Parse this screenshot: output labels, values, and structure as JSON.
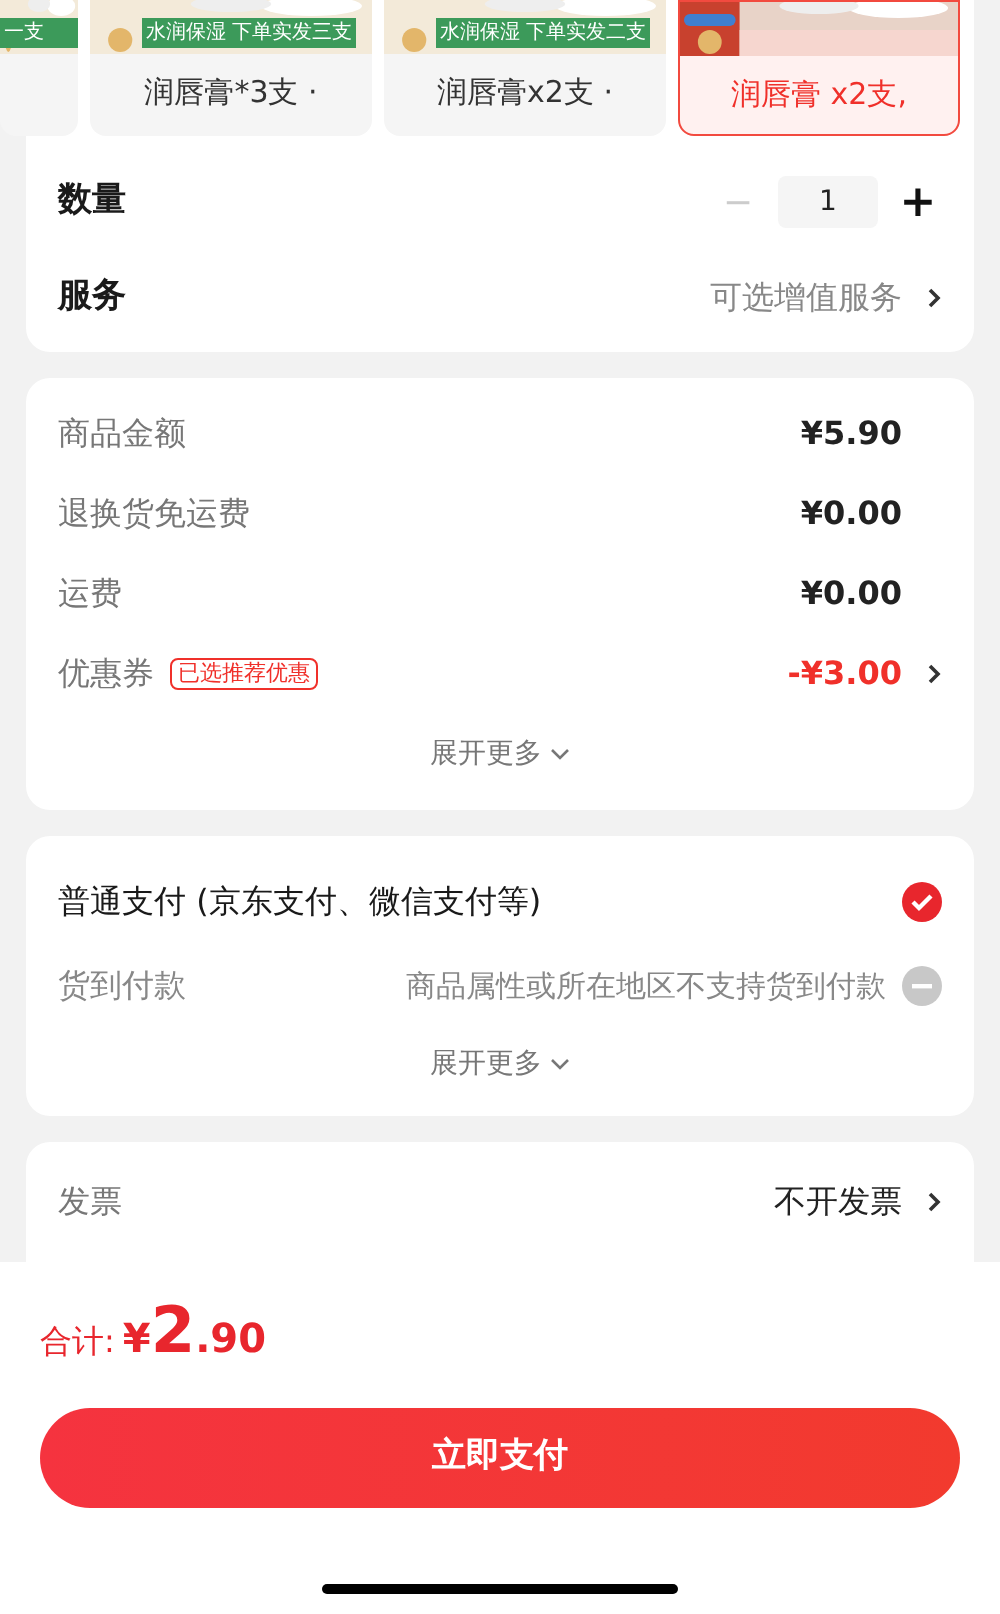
{
  "variants": [
    {
      "banner": "一支",
      "selected": false,
      "partial": true
    },
    {
      "banner": "水润保湿 下单实发三支",
      "label": "润唇膏*3支 ·",
      "selected": false,
      "partial": false
    },
    {
      "banner": "水润保湿 下单实发二支",
      "label": "润唇膏x2支 ·",
      "selected": false,
      "partial": false
    },
    {
      "label": "润唇膏 x2支,",
      "selected": true,
      "partial": false
    }
  ],
  "quantity": {
    "label": "数量",
    "value": "1",
    "minus": "−",
    "plus": "+",
    "minus_disabled": true
  },
  "service": {
    "label": "服务",
    "value": "可选增值服务"
  },
  "fees": [
    {
      "label": "商品金额",
      "value": "¥5.90",
      "highlight": false
    },
    {
      "label": "退换货免运费",
      "value": "¥0.00",
      "highlight": false
    },
    {
      "label": "运费",
      "value": "¥0.00",
      "highlight": false
    },
    {
      "label": "优惠券",
      "badge": "已选推荐优惠",
      "value": "-¥3.00",
      "highlight": true
    }
  ],
  "fees_more": "展开更多",
  "payments": [
    {
      "label": "普通支付 (京东支付、微信支付等)",
      "selected": true,
      "disabled": false
    },
    {
      "label": "货到付款",
      "note": "商品属性或所在地区不支持货到付款",
      "selected": false,
      "disabled": true
    }
  ],
  "payments_more": "展开更多",
  "invoice": {
    "label": "发票",
    "value": "不开发票"
  },
  "total": {
    "label": "合计:",
    "currency": "¥",
    "integer": "2",
    "decimal": ".90"
  },
  "pay_button": "立即支付"
}
